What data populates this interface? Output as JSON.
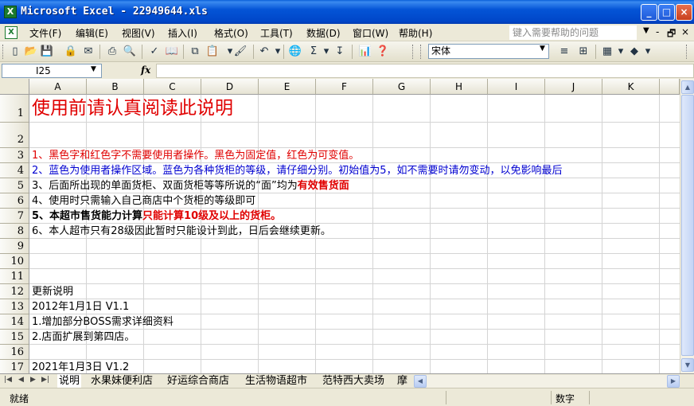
{
  "window": {
    "title": "Microsoft Excel - 22949644.xls",
    "minimize_label": "_",
    "maximize_label": "□",
    "close_label": "×"
  },
  "menu": {
    "items": [
      "文件(F)",
      "编辑(E)",
      "视图(V)",
      "插入(I)",
      "格式(O)",
      "工具(T)",
      "数据(D)",
      "窗口(W)",
      "帮助(H)"
    ],
    "help_placeholder": "键入需要帮助的问题",
    "doc_controls": [
      "-",
      "🗗",
      "×"
    ]
  },
  "toolbar": {
    "font_name": "宋体",
    "icons": [
      "new-icon",
      "open-icon",
      "save-icon",
      "permission-icon",
      "email-icon",
      "print-icon",
      "print-preview-icon",
      "spelling-icon",
      "research-icon",
      "cut-icon",
      "copy-icon",
      "paste-icon",
      "format-painter-icon",
      "undo-icon",
      "hyperlink-icon",
      "autosum-icon",
      "sort-icon",
      "chart-icon",
      "help-icon",
      "align-icon",
      "merge-icon",
      "borders-icon",
      "fill-color-icon"
    ]
  },
  "formula_bar": {
    "name_box": "I25",
    "fx_label": "fx",
    "value": ""
  },
  "grid": {
    "columns": [
      "A",
      "B",
      "C",
      "D",
      "E",
      "F",
      "G",
      "H",
      "I",
      "J",
      "K"
    ],
    "rows": [
      "1",
      "2",
      "3",
      "4",
      "5",
      "6",
      "7",
      "8",
      "9",
      "10",
      "11",
      "12",
      "13",
      "14",
      "15",
      "16",
      "17"
    ],
    "cells": {
      "r1": "使用前请认真阅读此说明",
      "r3": "1、黑色字和红色字不需要使用者操作。黑色为固定值，红色为可变值。",
      "r4": "2、蓝色为使用者操作区域。蓝色为各种货柜的等级，请仔细分别。初始值为5，如不需要时请勿变动，以免影响最后",
      "r5_a": "3、后面所出现的单面货柜、双面货柜等等所说的“面”均为",
      "r5_b": "有效售货面",
      "r6": "4、使用时只需输入自己商店中个货柜的等级即可",
      "r7_a": "5、本超市售货能力计算",
      "r7_b": "只能计算10级及以上的货柜。",
      "r8": "6、本人超市只有28级因此暂时只能设计到此，日后会继续更新。",
      "r12": "更新说明",
      "r13": "2012年1月1日  V1.1",
      "r14": "1.增加部分BOSS需求详细资料",
      "r15": "2.店面扩展到第四店。",
      "r17": "2021年1月3日  V1.2"
    }
  },
  "sheet_tabs": [
    "说明",
    "水果妹便利店",
    "好运综合商店",
    "生活物语超市",
    "范特西大卖场",
    "摩"
  ],
  "status": {
    "ready": "就绪",
    "num": "数字"
  },
  "colors": {
    "red_text": "#e00000",
    "blue_text": "#0000d0",
    "title_bar": "#0454d6"
  }
}
